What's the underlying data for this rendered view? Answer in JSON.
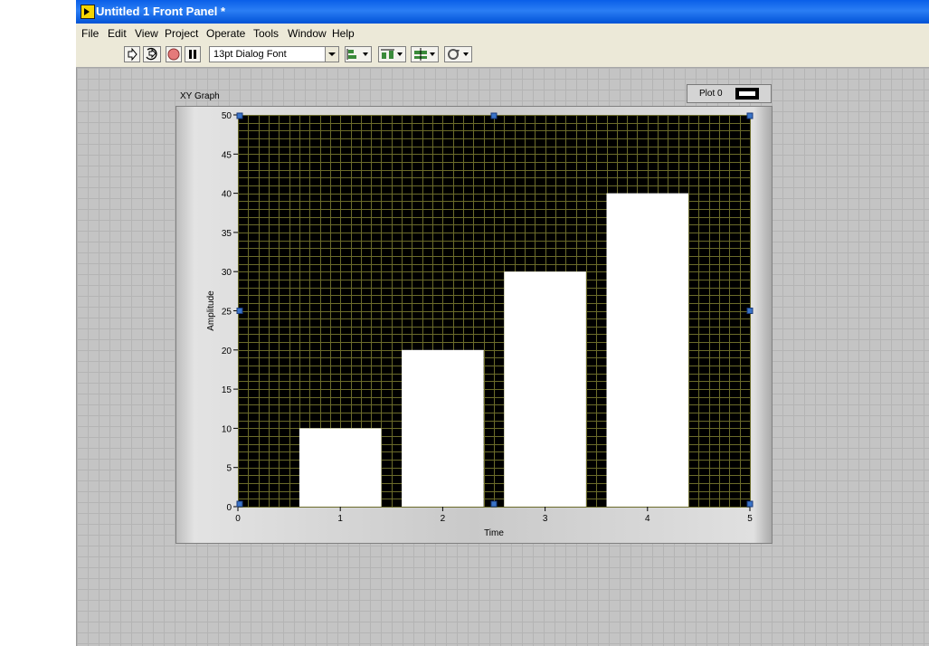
{
  "window": {
    "title": "Untitled 1 Front Panel *"
  },
  "menu": [
    {
      "label": "File"
    },
    {
      "label": "Edit"
    },
    {
      "label": "View"
    },
    {
      "label": "Project"
    },
    {
      "label": "Operate"
    },
    {
      "label": "Tools"
    },
    {
      "label": "Window"
    },
    {
      "label": "Help"
    }
  ],
  "toolbar": {
    "font_select": "13pt Dialog Font",
    "icons": [
      "run-arrow-icon",
      "run-continuously-icon",
      "abort-icon",
      "pause-icon",
      "align-objects-icon",
      "distribute-objects-icon",
      "resize-objects-icon",
      "reorder-icon"
    ]
  },
  "graph": {
    "label": "XY Graph",
    "legend_plot": "Plot 0"
  },
  "chart_data": {
    "type": "bar",
    "title": "",
    "xlabel": "Time",
    "ylabel": "Amplitude",
    "xlim": [
      0,
      5
    ],
    "ylim": [
      0,
      50
    ],
    "x_ticks": [
      0,
      1,
      2,
      3,
      4,
      5
    ],
    "y_ticks": [
      0,
      5,
      10,
      15,
      20,
      25,
      30,
      35,
      40,
      45,
      50
    ],
    "grid": true,
    "bar_width": 0.8,
    "series": [
      {
        "name": "Plot 0",
        "x": [
          1,
          2,
          3,
          4
        ],
        "values": [
          10,
          20,
          30,
          40
        ]
      }
    ],
    "colors": {
      "plot_bg": "#000000",
      "grid": "#6b6b2a",
      "bars": "#ffffff"
    },
    "legend_position": "top-right"
  }
}
